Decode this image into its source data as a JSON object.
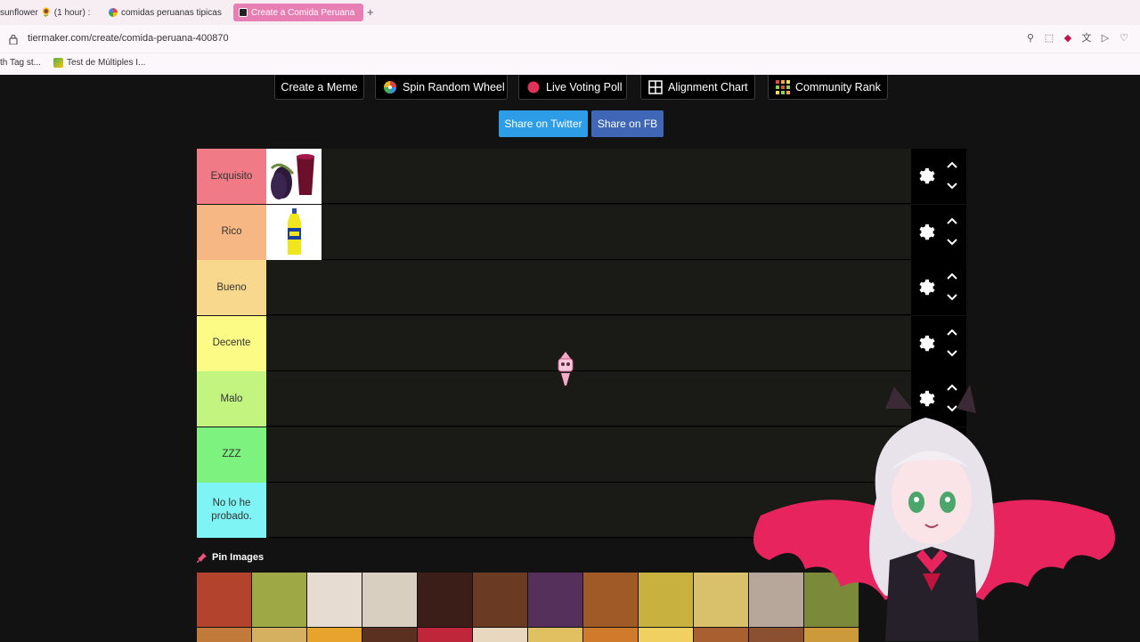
{
  "browser": {
    "tabs": [
      {
        "label": "sunflower 🌻 (1 hour) :",
        "active": false
      },
      {
        "label": "comidas peruanas tipicas",
        "active": false
      },
      {
        "label": "Create a Comida Peruana",
        "active": true
      }
    ],
    "new_tab": "+",
    "url": "tiermaker.com/create/comida-peruana-400870",
    "bookmarks": [
      "th Tag st...",
      "Test de Múltiples I..."
    ]
  },
  "toolbar": {
    "buttons": [
      {
        "label": "Create a Meme",
        "icon": "none"
      },
      {
        "label": "Spin Random Wheel",
        "icon": "wheel-icon"
      },
      {
        "label": "Live Voting Poll",
        "icon": "poll-dot-icon"
      },
      {
        "label": "Alignment Chart",
        "icon": "grid-icon"
      },
      {
        "label": "Community Rank",
        "icon": "rank-grid-icon"
      }
    ],
    "share": [
      {
        "label": "Share on Twitter",
        "color": "#2d9de8"
      },
      {
        "label": "Share on FB",
        "color": "#3f67b5"
      }
    ]
  },
  "tiers": [
    {
      "label": "Exquisito",
      "color": "#f07a85",
      "items": [
        "chicha-morada-image"
      ]
    },
    {
      "label": "Rico",
      "color": "#f7b784",
      "items": [
        "inca-kola-bottle-image"
      ]
    },
    {
      "label": "Bueno",
      "color": "#f8d88c",
      "items": []
    },
    {
      "label": "Decente",
      "color": "#fbfb86",
      "items": []
    },
    {
      "label": "Malo",
      "color": "#c2f47f",
      "items": []
    },
    {
      "label": "ZZZ",
      "color": "#7ef27f",
      "items": []
    },
    {
      "label": "No lo he probado.",
      "color": "#7ff4f4",
      "items": []
    }
  ],
  "pool": {
    "title": "Pin Images",
    "icon": "pin-icon",
    "image_count": 12,
    "colors": [
      "#b4432d",
      "#9ea845",
      "#e6dcd2",
      "#d8cfc0",
      "#3b1e17",
      "#6a3b22",
      "#54305a",
      "#a05a28",
      "#c8b13e",
      "#d9c06a",
      "#b7a79a",
      "#7a8a3a"
    ]
  }
}
